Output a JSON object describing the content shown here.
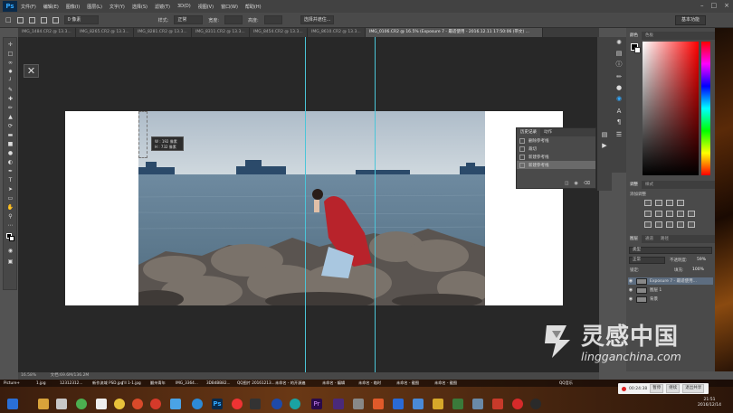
{
  "app": {
    "logo": "Ps"
  },
  "menu": [
    "文件(F)",
    "编辑(E)",
    "图像(I)",
    "图层(L)",
    "文字(Y)",
    "选择(S)",
    "滤镜(T)",
    "3D(D)",
    "视图(V)",
    "窗口(W)",
    "帮助(H)"
  ],
  "options": {
    "feather": "0 像素",
    "style_label": "样式:",
    "style_value": "正常",
    "width_label": "宽度:",
    "height_label": "高度:",
    "refine": "选择并遮住..."
  },
  "workspace": "基本功能",
  "tabs": [
    "IMG_1484.CR2 @ 13.3...",
    "IMG_8265.CR2 @ 13.3...",
    "IMG_8281.CR2 @ 13.3...",
    "IMG_8311.CR2 @ 13.3...",
    "IMG_8454.CR2 @ 13.3...",
    "IMG_8610.CR2 @ 13.3...",
    "IMG_0106.CR2 @ 16.5% (Exposure 7 - 最适使用 - 2016.12.11 17:50:06 (带文) ..."
  ],
  "tooltip": {
    "w": "W : 192 像素",
    "h": "H : 732 像素"
  },
  "status": {
    "zoom": "16.58%",
    "doc": "文档:69.6M/136.2M"
  },
  "history": {
    "tab_history": "历史记录",
    "tab_actions": "动作",
    "items": [
      "删除参考线",
      "裁切",
      "新建参考线",
      "新建参考线"
    ]
  },
  "panels": {
    "color_tab": "颜色",
    "swatches_tab": "色板",
    "adjust_tab": "调整",
    "styles_tab": "样式",
    "add_adjust": "添加调整",
    "layers_tab": "图层",
    "channels_tab": "通道",
    "paths_tab": "路径",
    "kind": "类型",
    "blend": "正常",
    "opacity_label": "不透明度:",
    "opacity": "59%",
    "lock_label": "锁定:",
    "fill_label": "填充:",
    "fill": "100%"
  },
  "layers": [
    {
      "name": "Exposure 7 - 最适使用..."
    },
    {
      "name": "图层 1"
    },
    {
      "name": "背景"
    }
  ],
  "taskbar_labels": [
    "Picture+",
    "1.jpg",
    "12312312...",
    "新作流域 PSD.jpg",
    "I'll 1-1.jpg",
    "翻州青年",
    "IMG_3364...",
    "3DB4BB82...",
    "QQ图片 20161213...",
    "未命名 - 的开源遍",
    "未命名 - 编辑",
    "未命名 - 临时",
    "未命名 - 截图",
    "未命名 - 截图",
    "QQ音乐"
  ],
  "recorder": {
    "time": "00:24:38",
    "pause": "暂停",
    "stop": "继续",
    "end": "退出共享"
  },
  "clock": {
    "time": "21:51",
    "date": "2016/12/14"
  },
  "watermark": {
    "title": "灵感中国",
    "url": "lingganchina.com"
  },
  "colors": {
    "accent": "#31a8ff",
    "guide": "#4bc5d8",
    "cloak": "#b8232b",
    "sea": "#5e7d92"
  }
}
